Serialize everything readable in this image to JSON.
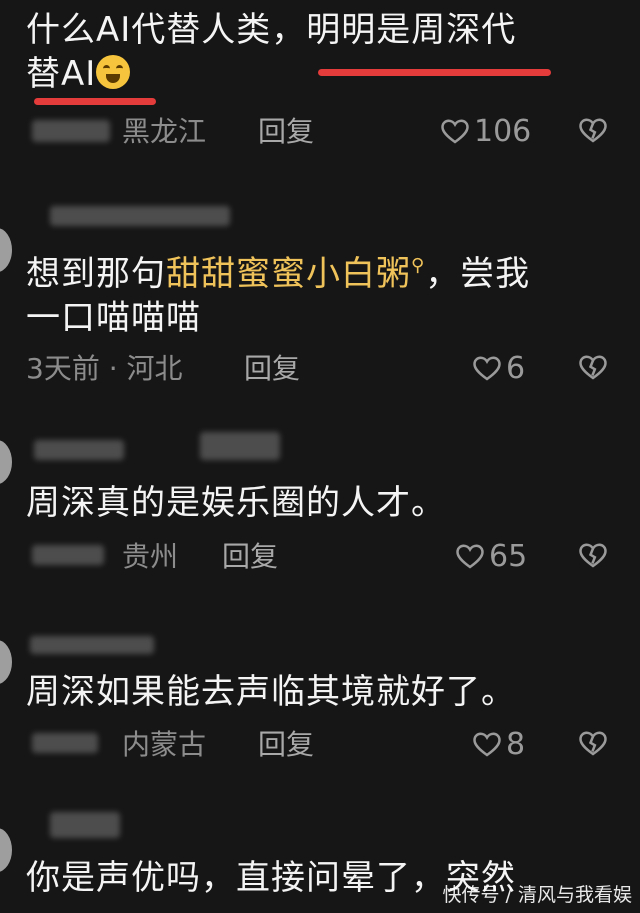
{
  "comments": [
    {
      "text_a": "什么AI代替人类，明明是周深代",
      "text_b": "替AI",
      "location": "黑龙江",
      "reply": "回复",
      "likes": "106"
    },
    {
      "text_a": "想到那句",
      "highlight": "甜甜蜜蜜小白粥",
      "text_b": "，尝我",
      "text_c": "一口喵喵喵",
      "time": "3天前 · 河北",
      "reply": "回复",
      "likes": "6"
    },
    {
      "text_a": "周深真的是娱乐圈的人才。",
      "location": "贵州",
      "reply": "回复",
      "likes": "65"
    },
    {
      "text_a": "周深如果能去声临其境就好了。",
      "location": "内蒙古",
      "reply": "回复",
      "likes": "8"
    },
    {
      "text_a": "你是声优吗，直接问晕了，突然"
    }
  ],
  "watermark": "快传号 / 清风与我看娱",
  "colors": {
    "background": "#161616",
    "highlight": "#f0c25a",
    "underline": "#e43b3b"
  }
}
